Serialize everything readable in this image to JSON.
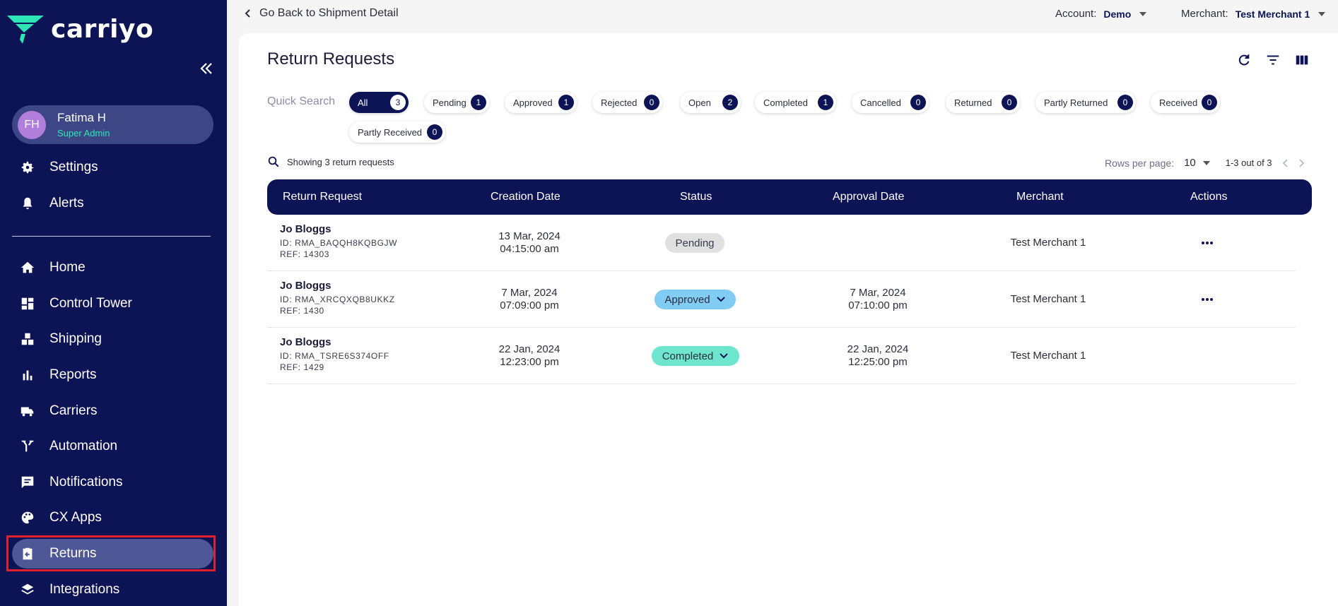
{
  "app": {
    "logo_text": "carriyo"
  },
  "sidebar": {
    "user": {
      "initials": "FH",
      "name": "Fatima H",
      "role": "Super Admin"
    },
    "top_items": [
      {
        "label": "Settings",
        "icon": "gear-icon"
      },
      {
        "label": "Alerts",
        "icon": "bell-icon"
      }
    ],
    "items": [
      {
        "label": "Home",
        "icon": "home-icon"
      },
      {
        "label": "Control Tower",
        "icon": "dashboard-icon"
      },
      {
        "label": "Shipping",
        "icon": "boxes-icon"
      },
      {
        "label": "Reports",
        "icon": "bar-chart-icon"
      },
      {
        "label": "Carriers",
        "icon": "truck-icon"
      },
      {
        "label": "Automation",
        "icon": "merge-icon"
      },
      {
        "label": "Notifications",
        "icon": "chat-icon"
      },
      {
        "label": "CX Apps",
        "icon": "palette-icon"
      },
      {
        "label": "Returns",
        "icon": "return-icon",
        "active": true
      },
      {
        "label": "Integrations",
        "icon": "layers-icon"
      }
    ]
  },
  "topbar": {
    "back_label": "Go Back to Shipment Detail",
    "account_label": "Account:",
    "account_value": "Demo",
    "merchant_label": "Merchant:",
    "merchant_value": "Test Merchant 1"
  },
  "page": {
    "title": "Return Requests",
    "quick_search_label": "Quick Search",
    "chips": [
      {
        "label": "All",
        "count": "3",
        "selected": true
      },
      {
        "label": "Pending",
        "count": "1"
      },
      {
        "label": "Approved",
        "count": "1"
      },
      {
        "label": "Rejected",
        "count": "0"
      },
      {
        "label": "Open",
        "count": "2"
      },
      {
        "label": "Completed",
        "count": "1"
      },
      {
        "label": "Cancelled",
        "count": "0"
      },
      {
        "label": "Returned",
        "count": "0"
      },
      {
        "label": "Partly Returned",
        "count": "0"
      },
      {
        "label": "Received",
        "count": "0"
      },
      {
        "label": "Partly Received",
        "count": "0"
      }
    ],
    "showing_text": "Showing 3 return requests",
    "rows_per_page_label": "Rows per page:",
    "rows_per_page_value": "10",
    "range_text": "1-3 out of 3"
  },
  "table": {
    "columns": [
      "Return Request",
      "Creation Date",
      "Status",
      "Approval Date",
      "Merchant",
      "Actions"
    ],
    "rows": [
      {
        "name": "Jo Bloggs",
        "id": "ID: RMA_BAQQH8KQBGJW",
        "ref": "REF: 14303",
        "created_date": "13 Mar, 2024",
        "created_time": "04:15:00 am",
        "status": "Pending",
        "approval_date": "",
        "approval_time": "",
        "merchant": "Test Merchant 1"
      },
      {
        "name": "Jo Bloggs",
        "id": "ID: RMA_XRCQXQB8UKKZ",
        "ref": "REF: 1430",
        "created_date": "7 Mar, 2024",
        "created_time": "07:09:00 pm",
        "status": "Approved",
        "approval_date": "7 Mar, 2024",
        "approval_time": "07:10:00 pm",
        "merchant": "Test Merchant 1"
      },
      {
        "name": "Jo Bloggs",
        "id": "ID: RMA_TSRE6S374OFF",
        "ref": "REF: 1429",
        "created_date": "22 Jan, 2024",
        "created_time": "12:23:00 pm",
        "status": "Completed",
        "approval_date": "22 Jan, 2024",
        "approval_time": "12:25:00 pm",
        "merchant": "Test Merchant 1"
      }
    ]
  },
  "colors": {
    "sidebar_bg": "#0c1456",
    "brand_green": "#2ee6b5",
    "pending": "#e0e0e0",
    "approved": "#80ccf2",
    "completed": "#6ee6cf",
    "highlight_outline": "#e0202c"
  }
}
